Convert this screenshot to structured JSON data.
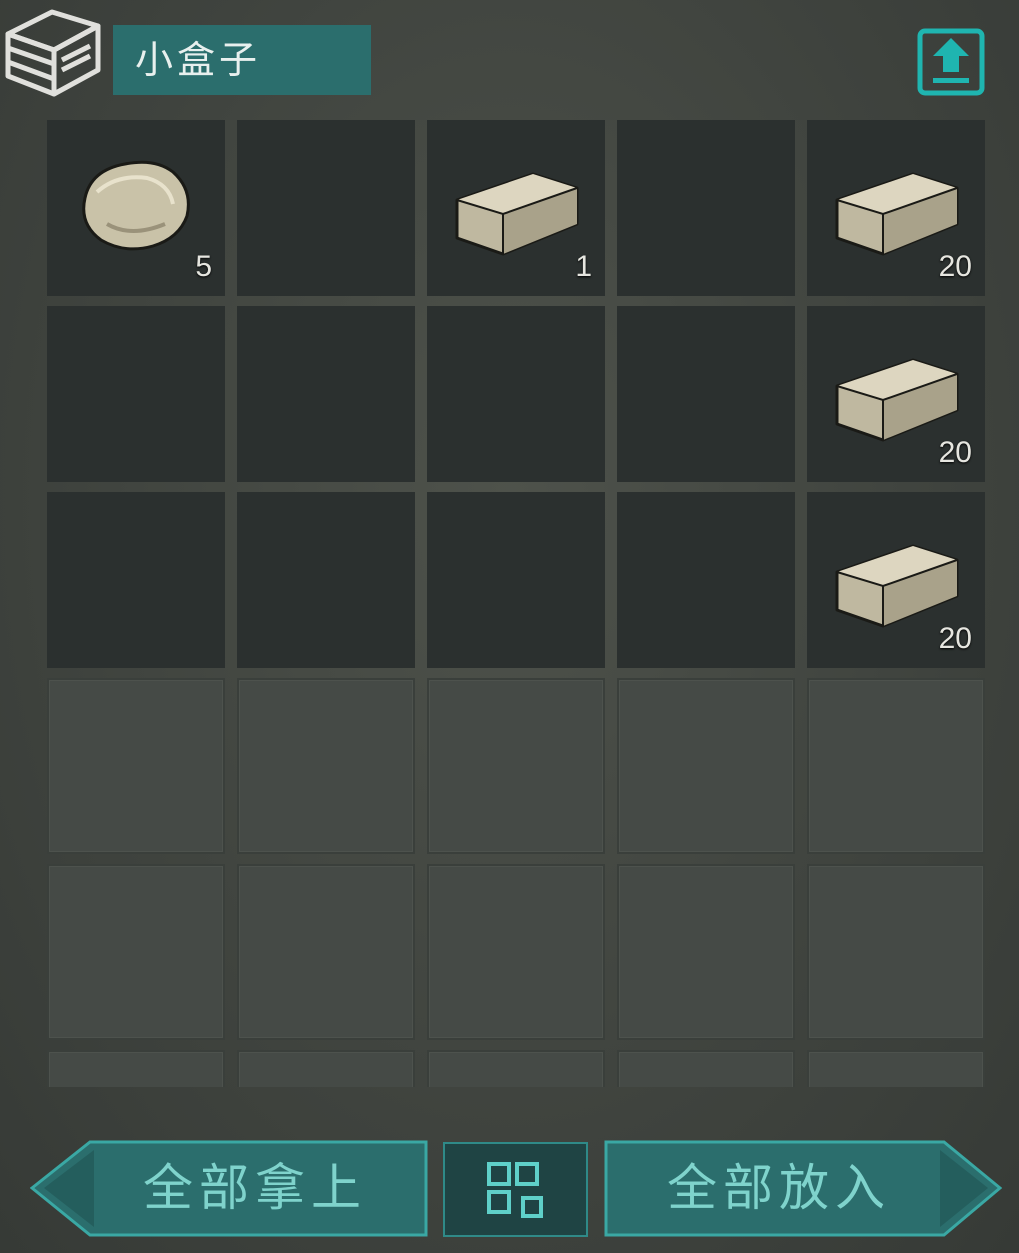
{
  "header": {
    "title": "小盒子",
    "container_icon": "storage-box-icon",
    "upload_icon": "upload-arrow-icon"
  },
  "grid": {
    "columns": 5,
    "slots": [
      {
        "item": "stone",
        "quantity": "5"
      },
      {
        "item": null,
        "quantity": ""
      },
      {
        "item": "stone-brick",
        "quantity": "1"
      },
      {
        "item": null,
        "quantity": ""
      },
      {
        "item": "stone-brick",
        "quantity": "20"
      },
      {
        "item": null,
        "quantity": ""
      },
      {
        "item": null,
        "quantity": ""
      },
      {
        "item": null,
        "quantity": ""
      },
      {
        "item": null,
        "quantity": ""
      },
      {
        "item": "stone-brick",
        "quantity": "20"
      },
      {
        "item": null,
        "quantity": ""
      },
      {
        "item": null,
        "quantity": ""
      },
      {
        "item": null,
        "quantity": ""
      },
      {
        "item": null,
        "quantity": ""
      },
      {
        "item": "stone-brick",
        "quantity": "20"
      }
    ]
  },
  "footer": {
    "take_all_label": "全部拿上",
    "put_all_label": "全部放入",
    "sort_icon": "sort-grid-icon"
  },
  "colors": {
    "accent": "#2b6e6d",
    "accent_text": "#7fd3cc",
    "icon_teal": "#1fb5b0"
  }
}
